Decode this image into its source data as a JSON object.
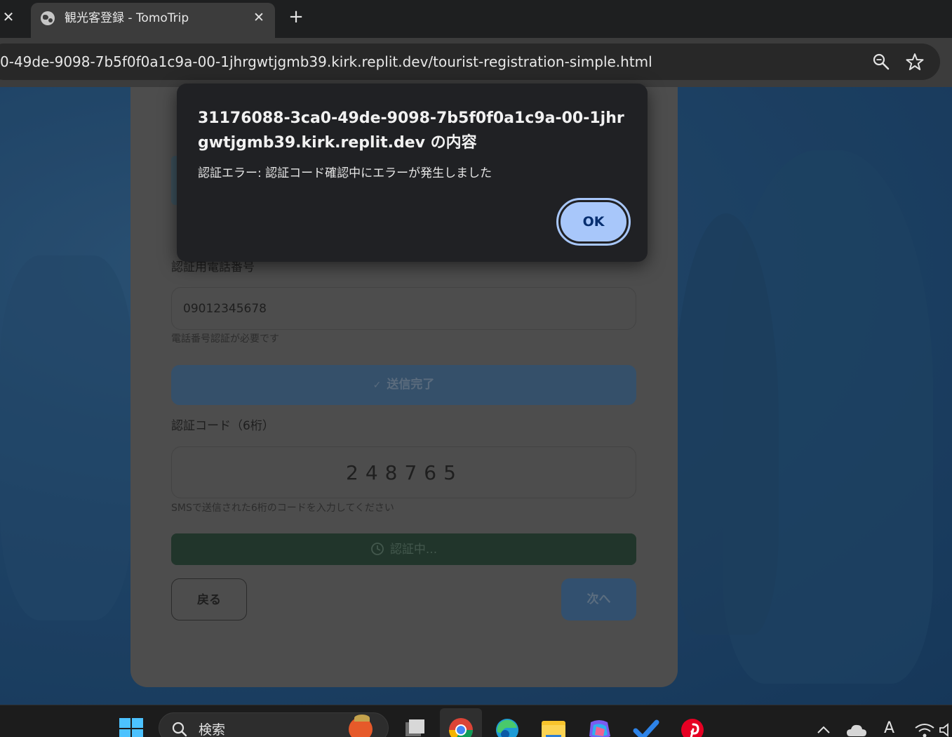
{
  "browser": {
    "prev_tab_close": "✕",
    "tab_title": "観光客登録 - TomoTrip",
    "tab_close": "✕",
    "new_tab": "+",
    "url": "0-49de-9098-7b5f0f0a1c9a-00-1jhrgwtjgmb39.kirk.replit.dev/tourist-registration-simple.html"
  },
  "form": {
    "phone_label": "認証用電話番号",
    "phone_value": "09012345678",
    "phone_hint": "電話番号認証が必要です",
    "send_button": "送信完了",
    "code_label": "認証コード（6桁）",
    "code_value": "248765",
    "code_hint": "SMSで送信された6桁のコードを入力してください",
    "verify_button": "認証中...",
    "back_button": "戻る",
    "next_button": "次へ"
  },
  "dialog": {
    "title": "31176088-3ca0-49de-9098-7b5f0f0a1c9a-00-1jhrgwtjgmb39.kirk.replit.dev の内容",
    "message": "認証エラー: 認証コード確認中にエラーが発生しました",
    "ok_button": "OK"
  },
  "taskbar": {
    "search_placeholder": "検索",
    "tray_font_indicator": "A"
  },
  "colors": {
    "dialog_bg": "#202124",
    "ok_accent": "#a8c7fa",
    "page_bg": "#2b5d8d"
  }
}
